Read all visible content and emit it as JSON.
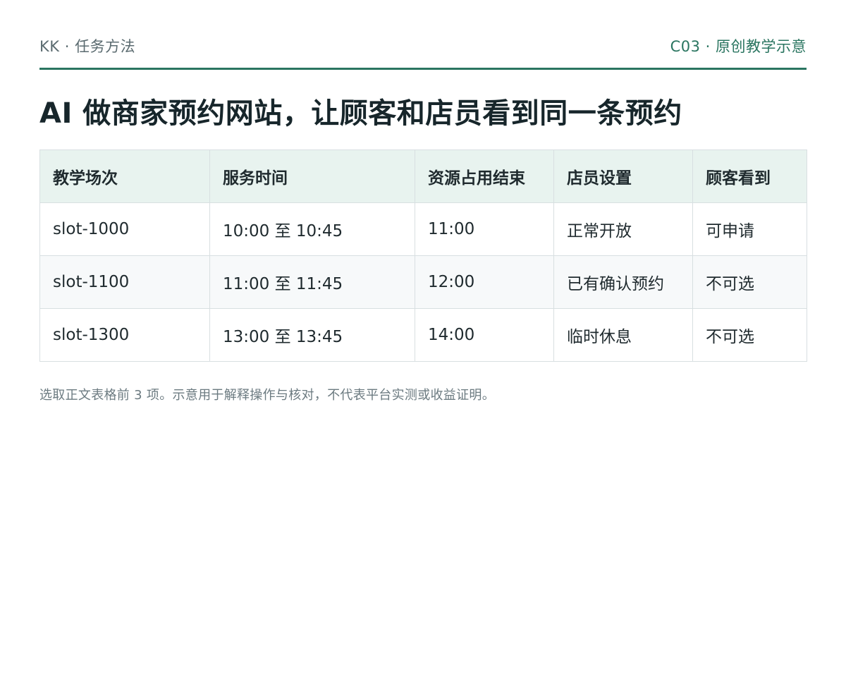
{
  "header": {
    "left": "KK · 任务方法",
    "right": "C03 · 原创教学示意"
  },
  "title": "AI 做商家预约网站，让顾客和店员看到同一条预约",
  "table": {
    "columns": [
      "教学场次",
      "服务时间",
      "资源占用结束",
      "店员设置",
      "顾客看到"
    ],
    "rows": [
      [
        "slot-1000",
        "10:00 至 10:45",
        "11:00",
        "正常开放",
        "可申请"
      ],
      [
        "slot-1100",
        "11:00 至 11:45",
        "12:00",
        "已有确认预约",
        "不可选"
      ],
      [
        "slot-1300",
        "13:00 至 13:45",
        "14:00",
        "临时休息",
        "不可选"
      ]
    ]
  },
  "note": "选取正文表格前 3 项。示意用于解释操作与核对，不代表平台实测或收益证明。",
  "colors": {
    "accent": "#2a7560",
    "header_bg": "#e8f3ef",
    "border": "#d8dfe1",
    "muted_text": "#6b7a80"
  }
}
